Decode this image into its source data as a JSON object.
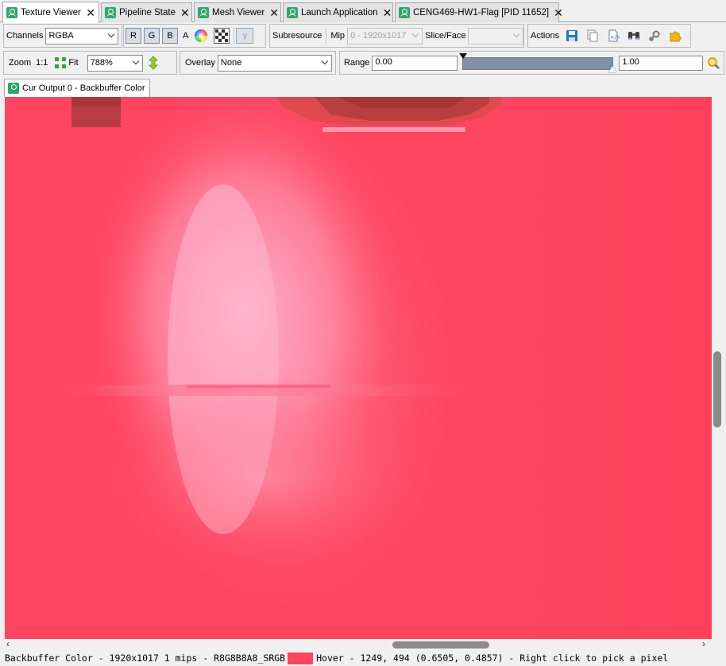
{
  "tabs": [
    {
      "label": "Texture Viewer",
      "active": true
    },
    {
      "label": "Pipeline State",
      "active": false
    },
    {
      "label": "Mesh Viewer",
      "active": false
    },
    {
      "label": "Launch Application",
      "active": false
    },
    {
      "label": "CENG469-HW1-Flag [PID 11652]",
      "active": false
    }
  ],
  "toolbar1": {
    "channels_label": "Channels",
    "channels_value": "RGBA",
    "channel_buttons": [
      "R",
      "G",
      "B"
    ],
    "alpha_label": "A",
    "gamma_label": "γ",
    "subresource_label": "Subresource",
    "mip_label": "Mip",
    "mip_value": "0 - 1920x1017",
    "slice_label": "Slice/Face",
    "slice_value": "",
    "actions_label": "Actions"
  },
  "toolbar2": {
    "zoom_label": "Zoom",
    "one_to_one_label": "1:1",
    "fit_label": "Fit",
    "zoom_value": "788%",
    "overlay_label": "Overlay",
    "overlay_value": "None",
    "range_label": "Range",
    "range_min": "0.00",
    "range_max": "1.00"
  },
  "output_tab": {
    "label": "Cur Output 0 - Backbuffer Color"
  },
  "status": {
    "text_before": "Backbuffer Color - 1920x1017 1 mips - R8G8B8A8_SRGB",
    "text_after": "Hover -  1249,  494 (0.6505, 0.4857)  - Right click to pick a pixel",
    "swatch_color": "#ff4560"
  },
  "colors": {
    "texture_base": "#ff4560",
    "highlight_pink": "#ffb0cc",
    "dark_red": "#b23a3a",
    "accent_green": "#2aa86a",
    "range_bar": "#8090a8"
  }
}
